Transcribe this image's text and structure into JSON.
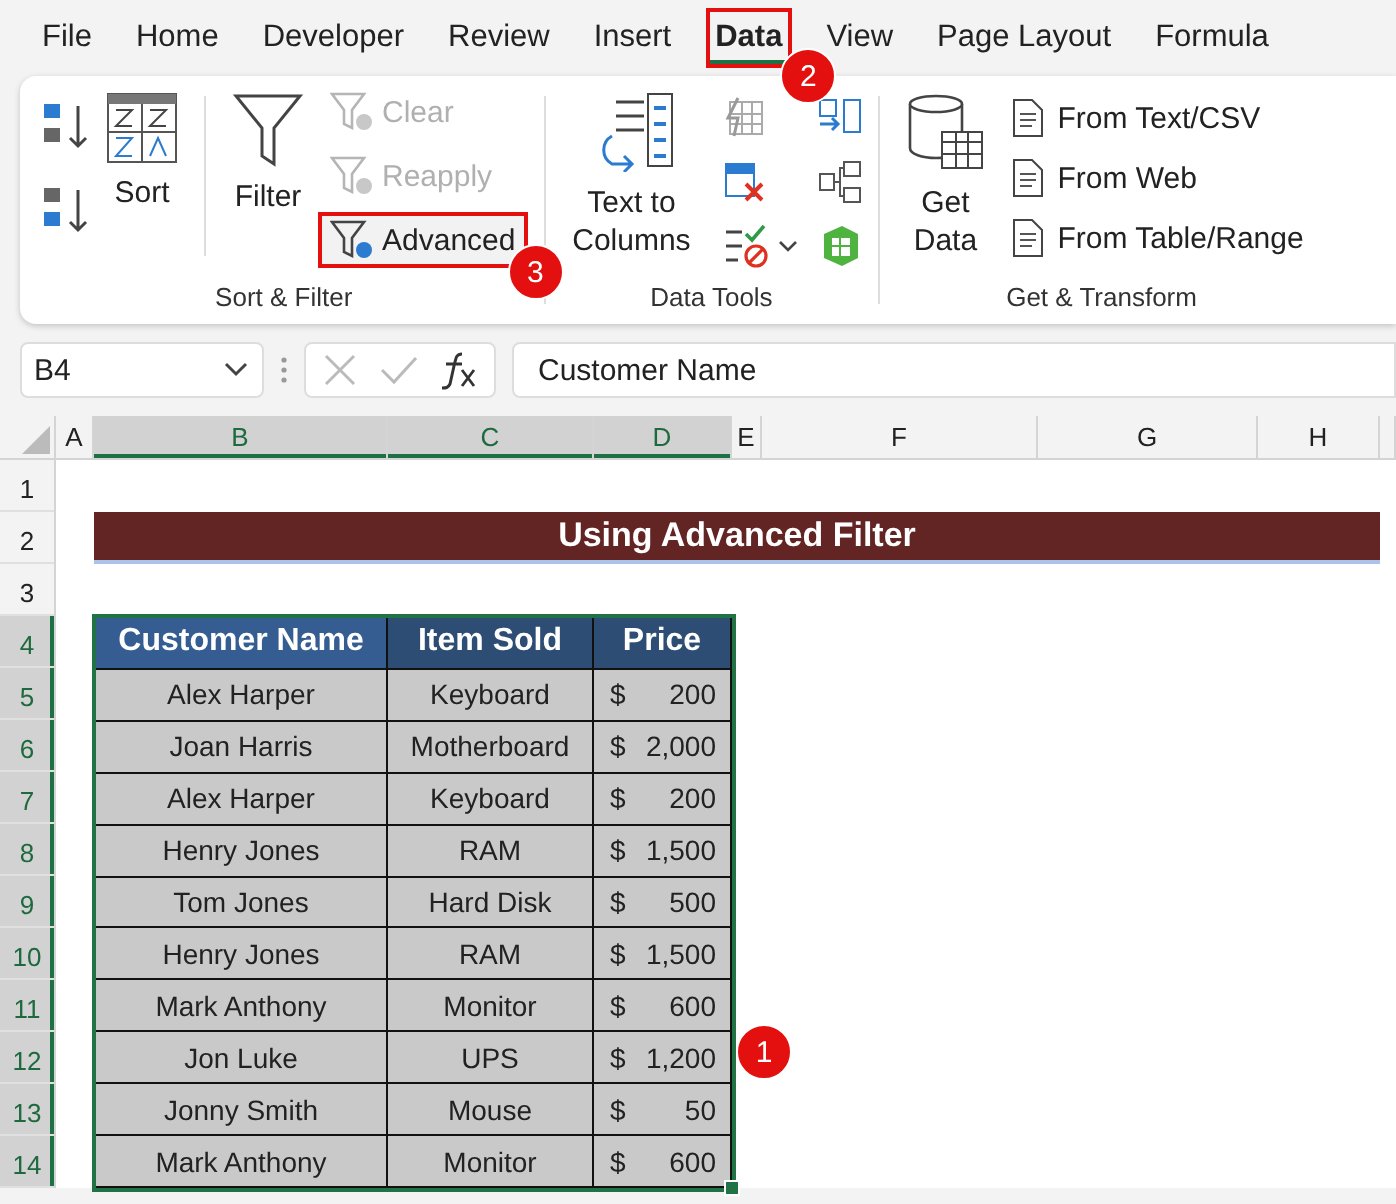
{
  "menu_tabs": [
    {
      "label": "File",
      "selected": false
    },
    {
      "label": "Home",
      "selected": false
    },
    {
      "label": "Developer",
      "selected": false
    },
    {
      "label": "Review",
      "selected": false
    },
    {
      "label": "Insert",
      "selected": false
    },
    {
      "label": "Data",
      "selected": true,
      "highlighted": true,
      "callout": "2"
    },
    {
      "label": "View",
      "selected": false
    },
    {
      "label": "Page Layout",
      "selected": false
    },
    {
      "label": "Formula",
      "selected": false
    }
  ],
  "ribbon": {
    "sort_filter": {
      "label": "Sort & Filter",
      "sort": "Sort",
      "filter": "Filter",
      "commands": [
        {
          "label": "Clear",
          "disabled": true,
          "highlighted": false
        },
        {
          "label": "Reapply",
          "disabled": true,
          "highlighted": false
        },
        {
          "label": "Advanced",
          "disabled": false,
          "highlighted": true,
          "callout": "3"
        }
      ]
    },
    "data_tools": {
      "label": "Data Tools",
      "text_to_columns": "Text to Columns"
    },
    "get_transform": {
      "label": "Get & Transform",
      "get_data": "Get Data",
      "sources": [
        "From Text/CSV",
        "From Web",
        "From Table/Range"
      ]
    }
  },
  "formula_bar": {
    "name_box": "B4",
    "formula": "Customer Name"
  },
  "columns": [
    {
      "label": "A",
      "selected": false
    },
    {
      "label": "B",
      "selected": true
    },
    {
      "label": "C",
      "selected": true
    },
    {
      "label": "D",
      "selected": true
    },
    {
      "label": "E",
      "selected": false
    },
    {
      "label": "F",
      "selected": false
    },
    {
      "label": "G",
      "selected": false
    },
    {
      "label": "H",
      "selected": false
    }
  ],
  "rows": [
    {
      "label": "1",
      "selected": false
    },
    {
      "label": "2",
      "selected": false
    },
    {
      "label": "3",
      "selected": false
    },
    {
      "label": "4",
      "selected": true
    },
    {
      "label": "5",
      "selected": true
    },
    {
      "label": "6",
      "selected": true
    },
    {
      "label": "7",
      "selected": true
    },
    {
      "label": "8",
      "selected": true
    },
    {
      "label": "9",
      "selected": true
    },
    {
      "label": "10",
      "selected": true
    },
    {
      "label": "11",
      "selected": true
    },
    {
      "label": "12",
      "selected": true
    },
    {
      "label": "13",
      "selected": true
    },
    {
      "label": "14",
      "selected": true
    }
  ],
  "sheet_title": "Using Advanced Filter",
  "table": {
    "callout": "1",
    "headers": [
      "Customer Name",
      "Item Sold",
      "Price"
    ],
    "rows": [
      {
        "name": "Alex Harper",
        "item": "Keyboard",
        "currency": "$",
        "price": "200"
      },
      {
        "name": "Joan Harris",
        "item": "Motherboard",
        "currency": "$",
        "price": "2,000"
      },
      {
        "name": "Alex Harper",
        "item": "Keyboard",
        "currency": "$",
        "price": "200"
      },
      {
        "name": "Henry Jones",
        "item": "RAM",
        "currency": "$",
        "price": "1,500"
      },
      {
        "name": "Tom Jones",
        "item": "Hard Disk",
        "currency": "$",
        "price": "500"
      },
      {
        "name": "Henry Jones",
        "item": "RAM",
        "currency": "$",
        "price": "1,500"
      },
      {
        "name": "Mark Anthony",
        "item": "Monitor",
        "currency": "$",
        "price": "600"
      },
      {
        "name": "Jon Luke",
        "item": "UPS",
        "currency": "$",
        "price": "1,200"
      },
      {
        "name": "Jonny Smith",
        "item": "Mouse",
        "currency": "$",
        "price": "50"
      },
      {
        "name": "Mark Anthony",
        "item": "Monitor",
        "currency": "$",
        "price": "600"
      }
    ]
  }
}
